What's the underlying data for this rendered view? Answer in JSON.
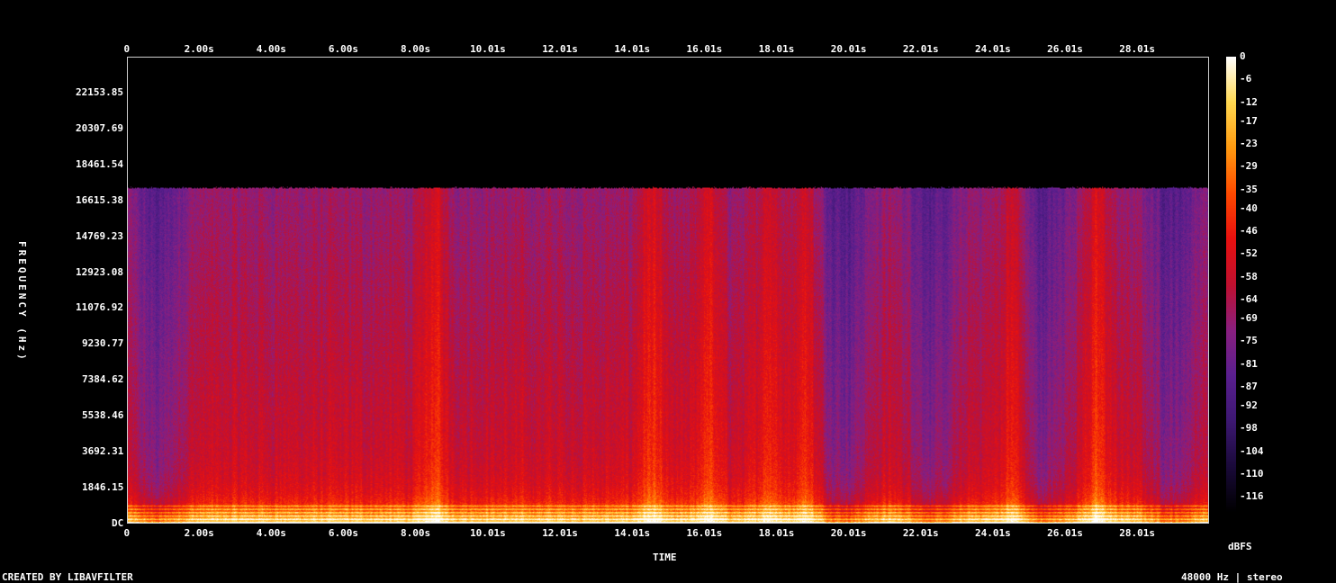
{
  "chart_data": {
    "type": "heatmap",
    "subtype": "spectrogram",
    "xlabel": "TIME",
    "ylabel": "FREQUENCY (Hz)",
    "x_ticks": [
      "0",
      "2.00s",
      "4.00s",
      "6.00s",
      "8.00s",
      "10.01s",
      "12.01s",
      "14.01s",
      "16.01s",
      "18.01s",
      "20.01s",
      "22.01s",
      "24.01s",
      "26.01s",
      "28.01s"
    ],
    "x_tick_values": [
      0,
      2.0,
      4.0,
      6.0,
      8.0,
      10.01,
      12.01,
      14.01,
      16.01,
      18.01,
      20.01,
      22.01,
      24.01,
      26.01,
      28.01
    ],
    "xlim": [
      0,
      30.0
    ],
    "y_ticks": [
      "DC",
      "1846.15",
      "3692.31",
      "5538.46",
      "7384.62",
      "9230.77",
      "11076.92",
      "12923.08",
      "14769.23",
      "16615.38",
      "18461.54",
      "20307.69",
      "22153.85"
    ],
    "y_tick_values": [
      0,
      1846.15,
      3692.31,
      5538.46,
      7384.62,
      9230.77,
      11076.92,
      12923.08,
      14769.23,
      16615.38,
      18461.54,
      20307.69,
      22153.85
    ],
    "ylim": [
      0,
      24000
    ],
    "cutoff_hz": 17300,
    "colorbar": {
      "label": "dBFS",
      "ticks": [
        "0",
        "-6",
        "-12",
        "-17",
        "-23",
        "-29",
        "-35",
        "-40",
        "-46",
        "-52",
        "-58",
        "-64",
        "-69",
        "-75",
        "-81",
        "-87",
        "-92",
        "-98",
        "-104",
        "-110",
        "-116"
      ],
      "tick_values": [
        0,
        -6,
        -12,
        -17,
        -23,
        -29,
        -35,
        -40,
        -46,
        -52,
        -58,
        -64,
        -69,
        -75,
        -81,
        -87,
        -92,
        -98,
        -104,
        -110,
        -116
      ],
      "range": [
        -120,
        0
      ]
    },
    "colormap": [
      "#000000",
      "#1a0a3a",
      "#3d1872",
      "#5a1f8f",
      "#8a1f80",
      "#c01030",
      "#e81010",
      "#ff4a00",
      "#ff9a10",
      "#ffd850",
      "#ffffff"
    ],
    "loud_time_bands_s": [
      8.5,
      14.5,
      16.1,
      17.8,
      18.8,
      24.6,
      26.9
    ],
    "quiet_time_bands_s": [
      0.8,
      19.9,
      22.4,
      25.4,
      29.0
    ]
  },
  "footer": {
    "credit": "CREATED BY LIBAVFILTER",
    "info": "48000 Hz | stereo"
  }
}
